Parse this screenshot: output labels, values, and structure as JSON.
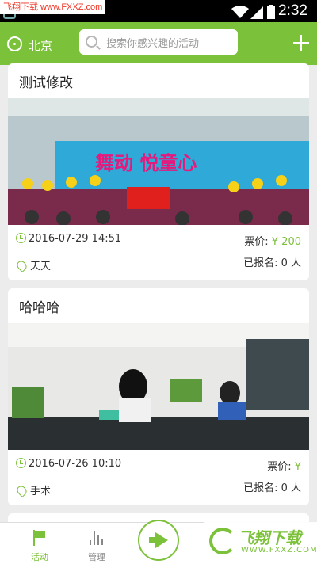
{
  "status_bar": {
    "time": "2:32",
    "watermark": "飞翔下载 www.FXXZ.com"
  },
  "header": {
    "city": "北京",
    "search_placeholder": "搜索你感兴趣的活动"
  },
  "activities": [
    {
      "title": "测试修改",
      "datetime": "2016-07-29 14:51",
      "price_label": "票价:",
      "price_value": "¥ 200",
      "location": "天天",
      "signup": "已报名: 0 人",
      "banner_text": "舞动 悦童心"
    },
    {
      "title": "哈哈哈",
      "datetime": "2016-07-26 10:10",
      "price_label": "票价:",
      "price_value": "¥",
      "location": "手术",
      "signup": "已报名: 0 人"
    }
  ],
  "bottom_nav": {
    "tabs": [
      {
        "label": "活动",
        "icon": "flag-icon",
        "active": true
      },
      {
        "label": "管理",
        "icon": "bar-chart-icon",
        "active": false
      },
      {
        "label": "",
        "icon": "megaphone-icon",
        "active": false
      }
    ],
    "watermark_logo": {
      "name": "飞翔下载",
      "url": "WWW.FXXZ.COM"
    }
  },
  "colors": {
    "accent": "#7cc13a",
    "background": "#ececec"
  }
}
